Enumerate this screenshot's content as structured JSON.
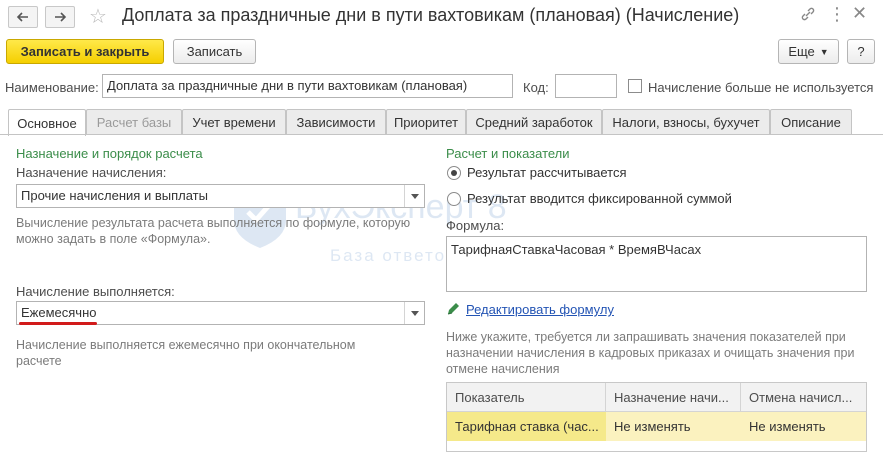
{
  "window": {
    "title": "Доплата за праздничные дни в пути вахтовикам (плановая) (Начисление)"
  },
  "toolbar": {
    "save_close_label": "Записать и закрыть",
    "save_label": "Записать",
    "more_label": "Еще",
    "help_label": "?"
  },
  "form": {
    "name_label": "Наименование:",
    "name_value": "Доплата за праздничные дни в пути вахтовикам (плановая)",
    "code_label": "Код:",
    "code_value": "",
    "not_used_label": "Начисление больше не используется"
  },
  "tabs": [
    {
      "label": "Основное"
    },
    {
      "label": "Расчет базы"
    },
    {
      "label": "Учет времени"
    },
    {
      "label": "Зависимости"
    },
    {
      "label": "Приоритет"
    },
    {
      "label": "Средний заработок"
    },
    {
      "label": "Налоги, взносы, бухучет"
    },
    {
      "label": "Описание"
    }
  ],
  "left": {
    "section_title": "Назначение и порядок расчета",
    "purpose_label": "Назначение начисления:",
    "purpose_value": "Прочие начисления и выплаты",
    "purpose_hint": "Вычисление результата расчета выполняется по формуле, которую можно задать в поле «Формула».",
    "performed_label": "Начисление выполняется:",
    "performed_value": "Ежемесячно",
    "performed_hint": "Начисление выполняется ежемесячно при окончательном расчете"
  },
  "right": {
    "section_title": "Расчет и показатели",
    "radio_calculated": "Результат рассчитывается",
    "radio_fixed": "Результат вводится фиксированной суммой",
    "formula_label": "Формула:",
    "formula_value": "ТарифнаяСтавкаЧасовая * ВремяВЧасах",
    "edit_formula_link": "Редактировать формулу",
    "indicators_hint": "Ниже укажите, требуется ли запрашивать значения показателей при назначении начисления в кадровых приказах и очищать значения при отмене начисления"
  },
  "table": {
    "headers": [
      "Показатель",
      "Назначение начи...",
      "Отмена начисл..."
    ],
    "rows": [
      [
        "Тарифная ставка (час...",
        "Не изменять",
        "Не изменять"
      ]
    ]
  },
  "watermark": {
    "brand": "БухЭксперт 8",
    "tagline": "База ответов по учету в 1С"
  },
  "colors": {
    "accent_yellow": "#f5cf00",
    "section_green": "#3b8d4a",
    "link_blue": "#2354b4",
    "underline_red": "#d11a1a"
  }
}
